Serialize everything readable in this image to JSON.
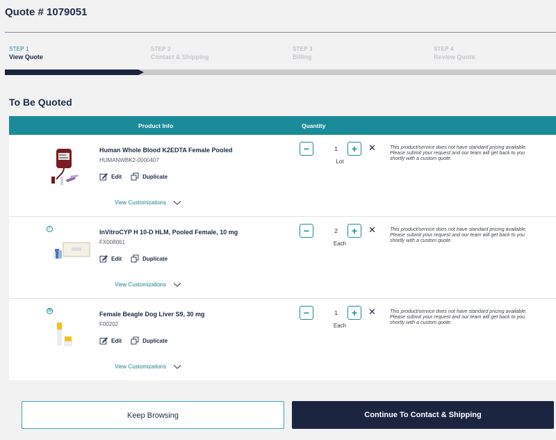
{
  "header": {
    "title": "Quote # 1079051"
  },
  "steps": [
    {
      "number": "STEP 1",
      "label": "View Quote",
      "active": true
    },
    {
      "number": "STEP 2",
      "label": "Contact & Shipping",
      "active": false
    },
    {
      "number": "STEP 3",
      "label": "Billing",
      "active": false
    },
    {
      "number": "STEP 4",
      "label": "Review Quote",
      "active": false
    }
  ],
  "progress": {
    "completed_steps": 1,
    "total_steps": 4
  },
  "section": {
    "title": "To Be Quoted"
  },
  "table": {
    "col_product": "Product Info",
    "col_quantity": "Quantity",
    "items": [
      {
        "name": "Human Whole Blood K2EDTA Female Pooled",
        "sku": "HUMANWBK2-0000407",
        "quantity": "1",
        "unit": "Lot",
        "edit_label": "Edit",
        "duplicate_label": "Duplicate",
        "customizations_label": "View Customizations",
        "note": "This product/service does not have standard pricing available. Please submit your request and our team will get back to you shortly with a custom quote.",
        "status_icon": ""
      },
      {
        "name": "InVitroCYP H 10-D HLM, Pooled Female, 10 mg",
        "sku": "FX008061",
        "quantity": "2",
        "unit": "Each",
        "edit_label": "Edit",
        "duplicate_label": "Duplicate",
        "customizations_label": "View Customizations",
        "note": "This product/service does not have standard pricing available. Please submit your request and our team will get back to you shortly with a custom quote.",
        "status_icon": "info-icon"
      },
      {
        "name": "Female Beagle Dog Liver S9, 30 mg",
        "sku": "F00202",
        "quantity": "1",
        "unit": "Each",
        "edit_label": "Edit",
        "duplicate_label": "Duplicate",
        "customizations_label": "View Customizations",
        "note": "This product/service does not have standard pricing available. Please submit your request and our team will get back to you shortly with a custom quote.",
        "status_icon": "clock-icon"
      }
    ]
  },
  "actions": {
    "keep_browsing": "Keep Browsing",
    "continue": "Continue To Contact & Shipping"
  },
  "colors": {
    "teal": "#1a8b99",
    "navy": "#1c2540"
  }
}
